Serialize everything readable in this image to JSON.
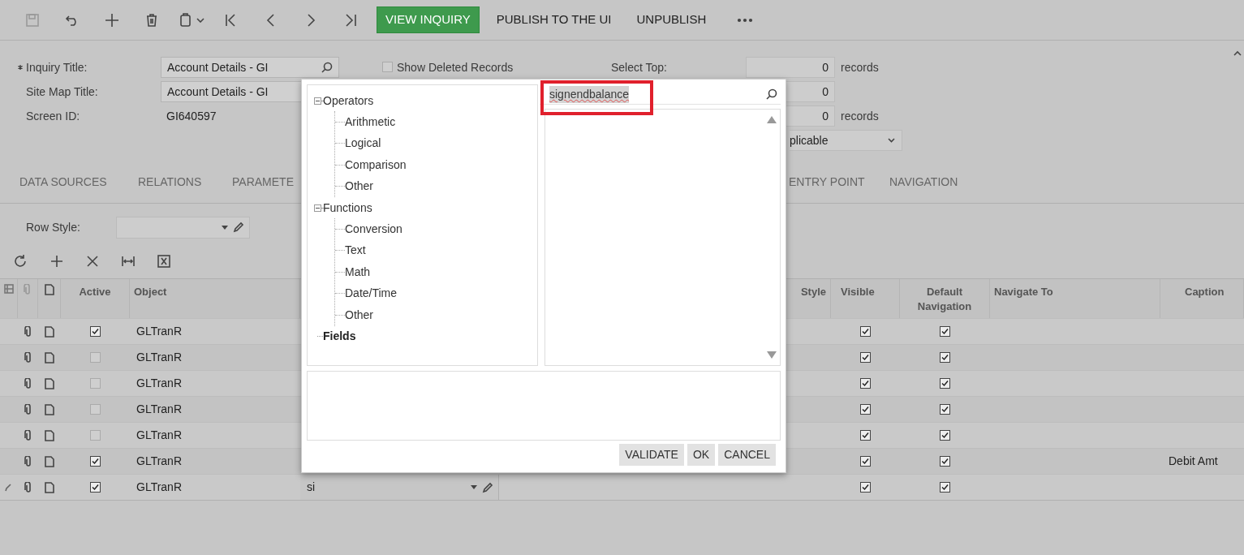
{
  "toolbar": {
    "actions": [
      {
        "label": "VIEW INQUIRY",
        "kind": "primary"
      },
      {
        "label": "PUBLISH TO THE UI",
        "kind": "plain"
      },
      {
        "label": "UNPUBLISH",
        "kind": "plain"
      }
    ]
  },
  "form": {
    "left_fields": [
      {
        "label": "Inquiry Title:",
        "value": "Account Details - GI",
        "required": true,
        "kind": "lookup"
      },
      {
        "label": "Site Map Title:",
        "value": "Account Details - GI",
        "required": false,
        "kind": "text"
      },
      {
        "label": "Screen ID:",
        "value": "GI640597",
        "required": false,
        "kind": "plain"
      }
    ],
    "show_deleted": {
      "label": "Show Deleted Records",
      "checked": false
    },
    "right_fields": [
      {
        "label": "Select Top:",
        "value": "0",
        "unit": "records",
        "kind": "number"
      },
      {
        "value": "0",
        "kind": "number"
      },
      {
        "value": "0",
        "unit": "records",
        "kind": "number"
      },
      {
        "value": "plicable",
        "kind": "dropdown"
      }
    ]
  },
  "tabs": [
    {
      "label": "DATA SOURCES",
      "selected": false
    },
    {
      "label": "RELATIONS",
      "selected": false
    },
    {
      "label": "PARAMETE",
      "selected": false
    },
    {
      "label": "ENTRY POINT",
      "selected": false
    },
    {
      "label": "NAVIGATION",
      "selected": false
    }
  ],
  "row_style": {
    "label": "Row Style:"
  },
  "table": {
    "columns": [
      "Active",
      "Object",
      "Style",
      "Visible",
      "Default Navigation",
      "Navigate To",
      "Caption"
    ],
    "rows": [
      {
        "active": true,
        "object": "GLTranR",
        "visible": true,
        "default_navigation": true,
        "editing": false
      },
      {
        "active": false,
        "object": "GLTranR",
        "visible": true,
        "default_navigation": true,
        "editing": false
      },
      {
        "active": false,
        "object": "GLTranR",
        "visible": true,
        "default_navigation": true,
        "editing": false
      },
      {
        "active": false,
        "object": "GLTranR",
        "visible": true,
        "default_navigation": true,
        "editing": false
      },
      {
        "active": false,
        "object": "GLTranR",
        "visible": true,
        "default_navigation": true,
        "editing": false
      },
      {
        "active": true,
        "object": "GLTranR",
        "visible": true,
        "default_navigation": true,
        "caption": "Debit Amt",
        "editing": false
      },
      {
        "active": true,
        "object": "GLTranR",
        "column_5": "si",
        "visible": true,
        "default_navigation": true,
        "editing": true
      }
    ]
  },
  "dialog": {
    "tree": [
      {
        "label": "Operators",
        "kind": "folder",
        "expanded": true,
        "children": [
          {
            "label": "Arithmetic"
          },
          {
            "label": "Logical"
          },
          {
            "label": "Comparison"
          },
          {
            "label": "Other"
          }
        ]
      },
      {
        "label": "Functions",
        "kind": "folder",
        "expanded": true,
        "children": [
          {
            "label": "Conversion"
          },
          {
            "label": "Text"
          },
          {
            "label": "Math"
          },
          {
            "label": "Date/Time"
          },
          {
            "label": "Other"
          }
        ]
      },
      {
        "label": "Fields",
        "kind": "category"
      }
    ],
    "search": {
      "value": "signendbalance",
      "highlighted": true
    },
    "buttons": [
      "VALIDATE",
      "OK",
      "CANCEL"
    ]
  }
}
